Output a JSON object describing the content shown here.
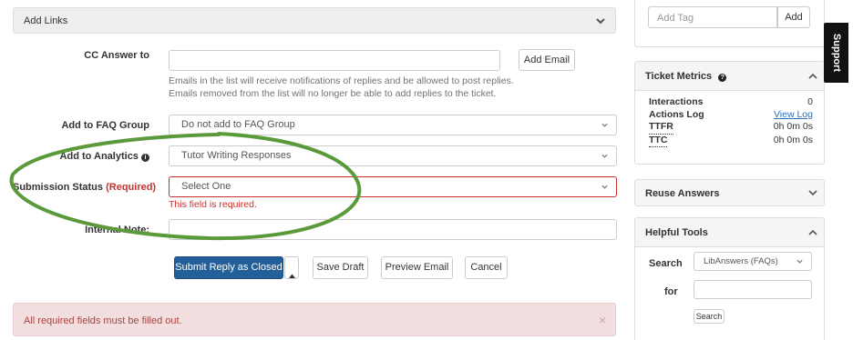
{
  "add_links": {
    "title": "Add Links"
  },
  "cc": {
    "label": "CC Answer to",
    "value": "",
    "add_email_label": "Add Email",
    "help_line1": "Emails in the list will receive notifications of replies and be allowed to post replies.",
    "help_line2": "Emails removed from the list will no longer be able to add replies to the ticket."
  },
  "faq_group": {
    "label": "Add to FAQ Group",
    "selected": "Do not add to FAQ Group"
  },
  "analytics": {
    "label": "Add to Analytics",
    "info_icon": "info-circle-icon",
    "selected": "Tutor Writing Responses"
  },
  "submission_status": {
    "label": "Submission Status",
    "required_text": "(Required)",
    "selected": "Select One",
    "error": "This field is required."
  },
  "internal_note": {
    "label": "Internal Note:",
    "value": ""
  },
  "actions": {
    "submit_label": "Submit Reply as Closed",
    "save_draft_label": "Save Draft",
    "preview_label": "Preview Email",
    "cancel_label": "Cancel"
  },
  "alert": {
    "message": "All required fields must be filled out.",
    "close": "×"
  },
  "sidebar": {
    "tag": {
      "placeholder": "Add Tag",
      "add_label": "Add"
    },
    "ticket_metrics": {
      "title": "Ticket Metrics",
      "rows": [
        {
          "label": "Interactions",
          "value": "0"
        },
        {
          "label": "Actions Log",
          "value": "View Log"
        },
        {
          "label": "TTFR",
          "value": "0h 0m 0s"
        },
        {
          "label": "TTC",
          "value": "0h 0m 0s"
        }
      ]
    },
    "reuse_answers": {
      "title": "Reuse Answers"
    },
    "helpful_tools": {
      "title": "Helpful Tools",
      "search_label": "Search",
      "search_source": "LibAnswers (FAQs)",
      "for_label": "for",
      "for_value": "",
      "search_button": "Search"
    }
  },
  "support_tab": {
    "label": "Support"
  },
  "colors": {
    "primary": "#23609a",
    "error": "#c9302c",
    "annotation": "#5a9a3a"
  }
}
